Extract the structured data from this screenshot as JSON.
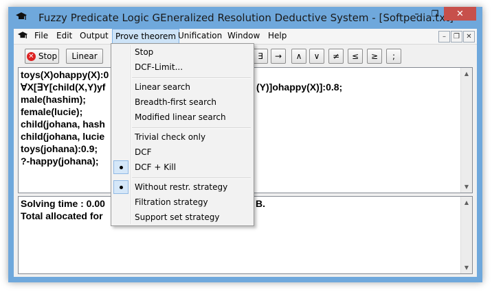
{
  "window": {
    "title": "Fuzzy Predicate Logic GEneralized Resolution Deductive System - [Softpedia.txt]"
  },
  "title_controls": {
    "minimize": "–",
    "maximize": "❐",
    "close": "✕"
  },
  "menubar": {
    "items": [
      "File",
      "Edit",
      "Output",
      "Prove theorem",
      "Unification",
      "Window",
      "Help"
    ],
    "mdi": [
      "–",
      "❐",
      "✕"
    ]
  },
  "toolbar": {
    "stop_label": "Stop",
    "linear_label": "Linear",
    "symbols": [
      "∃",
      "→",
      "∧",
      "∨",
      "≠",
      "≤",
      "≥",
      ";"
    ]
  },
  "editor": {
    "lines": [
      "toys(X)ohappy(X):0",
      "∀X[∃Y[child(X,Y)yf",
      "male(hashim);",
      "female(lucie);",
      "child(johana, hash",
      "child(johana, lucie",
      "toys(johana):0.9;",
      "?-happy(johana);"
    ],
    "line2_tail": "(Y)]ohappy(X)]:0.8;"
  },
  "output": {
    "lines": [
      "Solving time : 0.00",
      "Total allocated for"
    ],
    "line1_tail": "B."
  },
  "prove_menu": {
    "items": [
      {
        "label": "Stop",
        "checked": false
      },
      {
        "label": "DCF-Limit...",
        "checked": false
      },
      {
        "label": "Linear search",
        "checked": false
      },
      {
        "label": "Breadth-first search",
        "checked": false
      },
      {
        "label": "Modified linear search",
        "checked": false
      },
      {
        "label": "Trivial check only",
        "checked": false
      },
      {
        "label": "DCF",
        "checked": false
      },
      {
        "label": "DCF + Kill",
        "checked": true
      },
      {
        "label": "Without restr. strategy",
        "checked": true
      },
      {
        "label": "Filtration strategy",
        "checked": false
      },
      {
        "label": "Support set strategy",
        "checked": false
      }
    ]
  },
  "colors": {
    "frame": "#6fa8dc",
    "close": "#c7504b",
    "menu_highlight": "#cde3f7"
  }
}
